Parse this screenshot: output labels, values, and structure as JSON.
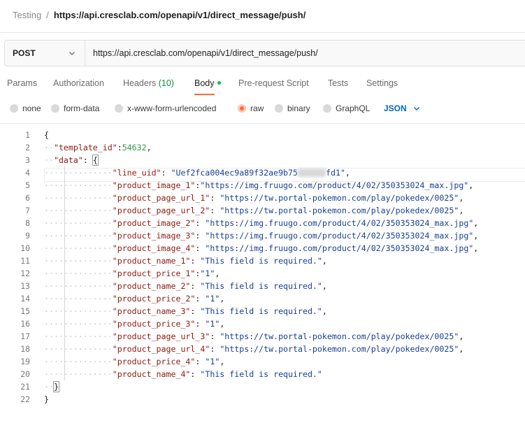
{
  "breadcrumb": {
    "parent": "Testing",
    "separator": "/",
    "current": "https://api.cresclab.com/openapi/v1/direct_message/push/"
  },
  "request": {
    "method": "POST",
    "url": "https://api.cresclab.com/openapi/v1/direct_message/push/"
  },
  "tabs": {
    "params": "Params",
    "authorization": "Authorization",
    "headers": "Headers",
    "headers_count": "(10)",
    "body": "Body",
    "pre_request": "Pre-request Script",
    "tests": "Tests",
    "settings": "Settings",
    "active": "Body"
  },
  "body_options": {
    "none": "none",
    "form_data": "form-data",
    "urlencoded": "x-www-form-urlencoded",
    "raw": "raw",
    "binary": "binary",
    "graphql": "GraphQL",
    "selected": "raw",
    "format": "JSON"
  },
  "colors": {
    "accent": "#ff6c37",
    "json_key": "#8b1a10",
    "json_string": "#1a3f93",
    "json_number": "#2f9a49",
    "format_blue": "#0265d2",
    "headers_count": "#0f8f3f"
  },
  "editor": {
    "line_numbers": [
      "1",
      "2",
      "3",
      "4",
      "5",
      "6",
      "7",
      "8",
      "9",
      "10",
      "11",
      "12",
      "13",
      "14",
      "15",
      "16",
      "17",
      "18",
      "19",
      "20",
      "21",
      "22"
    ],
    "open_brace": "{",
    "close_brace": "}",
    "template_key": "\"template_id\"",
    "template_value": "54632",
    "data_key": "\"data\"",
    "line_uid_key": "\"line_uid\"",
    "line_uid_value_start": "\"Uef2fca004ec9a89f32ae9b75",
    "line_uid_value_end": "fd1\"",
    "rows": [
      {
        "key": "\"product_image_1\"",
        "sep": ":",
        "value": "\"https://img.fruugo.com/product/4/02/350353024_max.jpg\"",
        "comma": ","
      },
      {
        "key": "\"product_page_url_1\"",
        "sep": ": ",
        "value": "\"https://tw.portal-pokemon.com/play/pokedex/0025\"",
        "comma": ","
      },
      {
        "key": "\"product_page_url_2\"",
        "sep": ": ",
        "value": "\"https://tw.portal-pokemon.com/play/pokedex/0025\"",
        "comma": ","
      },
      {
        "key": "\"product_image_2\"",
        "sep": ": ",
        "value": "\"https://img.fruugo.com/product/4/02/350353024_max.jpg\"",
        "comma": ","
      },
      {
        "key": "\"product_image_3\"",
        "sep": ": ",
        "value": "\"https://img.fruugo.com/product/4/02/350353024_max.jpg\"",
        "comma": ","
      },
      {
        "key": "\"product_image_4\"",
        "sep": ": ",
        "value": "\"https://img.fruugo.com/product/4/02/350353024_max.jpg\"",
        "comma": ","
      },
      {
        "key": "\"product_name_1\"",
        "sep": ": ",
        "value": "\"This field is required.\"",
        "comma": ","
      },
      {
        "key": "\"product_price_1\"",
        "sep": ":",
        "value": "\"1\"",
        "comma": ","
      },
      {
        "key": "\"product_name_2\"",
        "sep": ": ",
        "value": "\"This field is required.\"",
        "comma": ","
      },
      {
        "key": "\"product_price_2\"",
        "sep": ": ",
        "value": "\"1\"",
        "comma": ","
      },
      {
        "key": "\"product_name_3\"",
        "sep": ": ",
        "value": "\"This field is required.\"",
        "comma": ","
      },
      {
        "key": "\"product_price_3\"",
        "sep": ": ",
        "value": "\"1\"",
        "comma": ","
      },
      {
        "key": "\"product_page_url_3\"",
        "sep": ": ",
        "value": "\"https://tw.portal-pokemon.com/play/pokedex/0025\"",
        "comma": ","
      },
      {
        "key": "\"product_page_url_4\"",
        "sep": ": ",
        "value": "\"https://tw.portal-pokemon.com/play/pokedex/0025\"",
        "comma": ","
      },
      {
        "key": "\"product_price_4\"",
        "sep": ": ",
        "value": "\"1\"",
        "comma": ","
      },
      {
        "key": "\"product_name_4\"",
        "sep": ": ",
        "value": "\"This field is required.\"",
        "comma": ""
      }
    ]
  }
}
